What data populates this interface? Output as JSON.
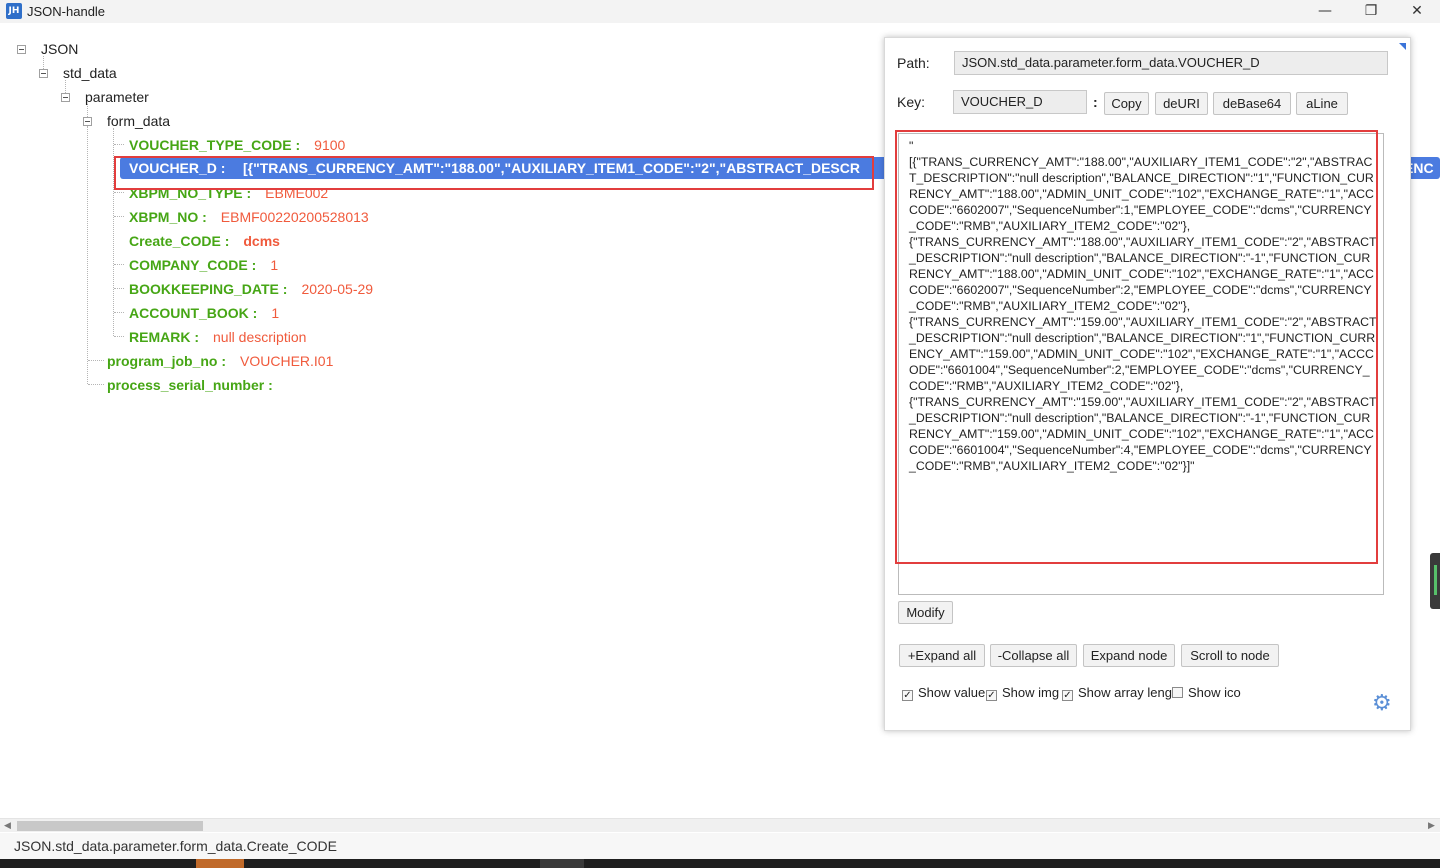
{
  "window": {
    "icon_text": "JH",
    "title": "JSON-handle",
    "minimize": "—",
    "maximize": "❐",
    "close": "✕"
  },
  "tree": {
    "root": "JSON",
    "std_data": "std_data",
    "parameter": "parameter",
    "form_data": "form_data",
    "fields": [
      {
        "key": "VOUCHER_TYPE_CODE :",
        "value": "9100"
      },
      {
        "key": "VOUCHER_D :",
        "value": "[{\"TRANS_CURRENCY_AMT\":\"188.00\",\"AUXILIARY_ITEM1_CODE\":\"2\",\"ABSTRACT_DESCR"
      },
      {
        "key": "XBPM_NO_TYPE :",
        "value": "EBME002"
      },
      {
        "key": "XBPM_NO :",
        "value": "EBMF00220200528013"
      },
      {
        "key": "Create_CODE :",
        "value": "dcms"
      },
      {
        "key": "COMPANY_CODE :",
        "value": "1"
      },
      {
        "key": "BOOKKEEPING_DATE :",
        "value": "2020-05-29"
      },
      {
        "key": "ACCOUNT_BOOK :",
        "value": "1"
      },
      {
        "key": "REMARK :",
        "value": "null description"
      }
    ],
    "selected_overflow": "ENC",
    "program_job_no": {
      "key": "program_job_no :",
      "value": "VOUCHER.I01"
    },
    "process_serial_number": {
      "key": "process_serial_number :",
      "value": ""
    }
  },
  "panel": {
    "path_label": "Path:",
    "path_value": "JSON.std_data.parameter.form_data.VOUCHER_D",
    "key_label": "Key:",
    "key_value": "VOUCHER_D",
    "colon": ":",
    "copy": "Copy",
    "deuri": "deURI",
    "debase64": "deBase64",
    "aline": "aLine",
    "value_text": "\"\n[{\"TRANS_CURRENCY_AMT\":\"188.00\",\"AUXILIARY_ITEM1_CODE\":\"2\",\"ABSTRACT_DESCRIPTION\":\"null description\",\"BALANCE_DIRECTION\":\"1\",\"FUNCTION_CURRENCY_AMT\":\"188.00\",\"ADMIN_UNIT_CODE\":\"102\",\"EXCHANGE_RATE\":\"1\",\"ACCCODE\":\"6602007\",\"SequenceNumber\":1,\"EMPLOYEE_CODE\":\"dcms\",\"CURRENCY_CODE\":\"RMB\",\"AUXILIARY_ITEM2_CODE\":\"02\"},\n{\"TRANS_CURRENCY_AMT\":\"188.00\",\"AUXILIARY_ITEM1_CODE\":\"2\",\"ABSTRACT_DESCRIPTION\":\"null description\",\"BALANCE_DIRECTION\":\"-1\",\"FUNCTION_CURRENCY_AMT\":\"188.00\",\"ADMIN_UNIT_CODE\":\"102\",\"EXCHANGE_RATE\":\"1\",\"ACCCODE\":\"6602007\",\"SequenceNumber\":2,\"EMPLOYEE_CODE\":\"dcms\",\"CURRENCY_CODE\":\"RMB\",\"AUXILIARY_ITEM2_CODE\":\"02\"},\n{\"TRANS_CURRENCY_AMT\":\"159.00\",\"AUXILIARY_ITEM1_CODE\":\"2\",\"ABSTRACT_DESCRIPTION\":\"null description\",\"BALANCE_DIRECTION\":\"1\",\"FUNCTION_CURRENCY_AMT\":\"159.00\",\"ADMIN_UNIT_CODE\":\"102\",\"EXCHANGE_RATE\":\"1\",\"ACCCODE\":\"6601004\",\"SequenceNumber\":2,\"EMPLOYEE_CODE\":\"dcms\",\"CURRENCY_CODE\":\"RMB\",\"AUXILIARY_ITEM2_CODE\":\"02\"},\n{\"TRANS_CURRENCY_AMT\":\"159.00\",\"AUXILIARY_ITEM1_CODE\":\"2\",\"ABSTRACT_DESCRIPTION\":\"null description\",\"BALANCE_DIRECTION\":\"-1\",\"FUNCTION_CURRENCY_AMT\":\"159.00\",\"ADMIN_UNIT_CODE\":\"102\",\"EXCHANGE_RATE\":\"1\",\"ACCCODE\":\"6601004\",\"SequenceNumber\":4,\"EMPLOYEE_CODE\":\"dcms\",\"CURRENCY_CODE\":\"RMB\",\"AUXILIARY_ITEM2_CODE\":\"02\"}]\"",
    "modify": "Modify",
    "expand_all": "+Expand all",
    "collapse_all": "-Collapse all",
    "expand_node": "Expand node",
    "scroll_to_node": "Scroll to node",
    "checks": [
      {
        "label": "Show value",
        "checked": true
      },
      {
        "label": "Show img",
        "checked": true
      },
      {
        "label": "Show array leng",
        "checked": true
      },
      {
        "label": "Show ico",
        "checked": false
      }
    ],
    "gear_icon": "⚙"
  },
  "scrollbar": {
    "left_arrow": "◀",
    "right_arrow": "▶"
  },
  "status_path": "JSON.std_data.parameter.form_data.Create_CODE",
  "colors": {
    "key_green": "#46a615",
    "value_orange": "#f05a3c",
    "selection_blue": "#4b7be0",
    "highlight_red": "#e23d3d"
  }
}
